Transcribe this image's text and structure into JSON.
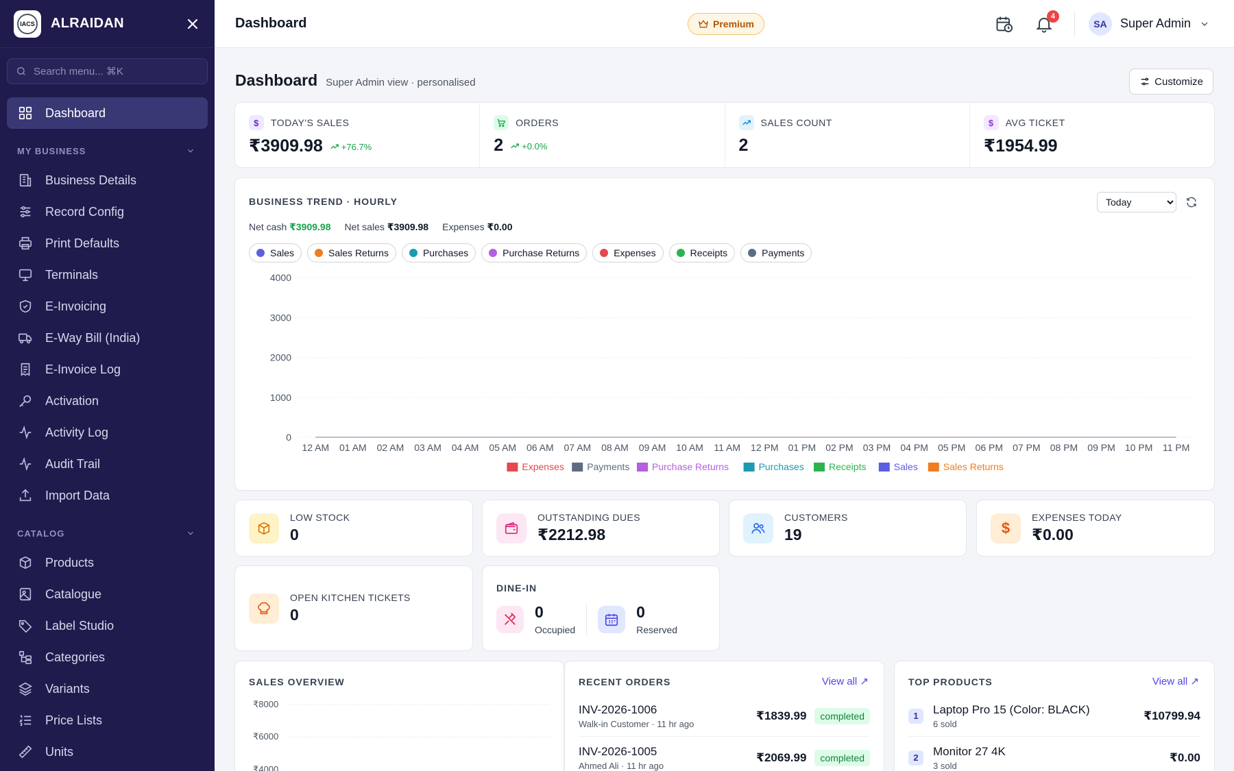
{
  "sidebar": {
    "brand": "ALRAIDAN",
    "logo_text": "IACS",
    "search_placeholder": "Search menu... ⌘K",
    "active_item": "Dashboard",
    "sections": [
      {
        "label": "MY BUSINESS",
        "items": [
          "Business Details",
          "Record Config",
          "Print Defaults",
          "Terminals",
          "E-Invoicing",
          "E-Way Bill (India)",
          "E-Invoice Log",
          "Activation",
          "Activity Log",
          "Audit Trail",
          "Import Data"
        ]
      },
      {
        "label": "CATALOG",
        "items": [
          "Products",
          "Catalogue",
          "Label Studio",
          "Categories",
          "Variants",
          "Price Lists",
          "Units"
        ]
      }
    ]
  },
  "topbar": {
    "title": "Dashboard",
    "premium": "Premium",
    "notifications_count": "4",
    "avatar_initials": "SA",
    "user_name": "Super Admin"
  },
  "page": {
    "title": "Dashboard",
    "subtitle": "Super Admin view · personalised",
    "customize_label": "Customize"
  },
  "kpis": [
    {
      "label": "TODAY'S SALES",
      "value": "₹3909.98",
      "trend": "+76.7%",
      "icon": "dollar-icon"
    },
    {
      "label": "ORDERS",
      "value": "2",
      "trend": "+0.0%",
      "icon": "cart-icon"
    },
    {
      "label": "SALES COUNT",
      "value": "2",
      "trend": "",
      "icon": "trend-up-icon"
    },
    {
      "label": "AVG TICKET",
      "value": "₹1954.99",
      "trend": "",
      "icon": "dollar-icon"
    }
  ],
  "trend": {
    "title": "BUSINESS TREND · HOURLY",
    "range_selected": "Today",
    "stats": [
      {
        "label": "Net cash",
        "value": "₹3909.98"
      },
      {
        "label": "Net sales",
        "value": "₹3909.98"
      },
      {
        "label": "Expenses",
        "value": "₹0.00"
      }
    ],
    "pills": [
      {
        "label": "Sales",
        "color": "#5b5fe0"
      },
      {
        "label": "Sales Returns",
        "color": "#f07c1e"
      },
      {
        "label": "Purchases",
        "color": "#1b9bb0"
      },
      {
        "label": "Purchase Returns",
        "color": "#b45ee0"
      },
      {
        "label": "Expenses",
        "color": "#e5484d"
      },
      {
        "label": "Receipts",
        "color": "#2cb34f"
      },
      {
        "label": "Payments",
        "color": "#5d6b85"
      }
    ]
  },
  "chart_data": {
    "type": "line",
    "x": [
      "12 AM",
      "01 AM",
      "02 AM",
      "03 AM",
      "04 AM",
      "05 AM",
      "06 AM",
      "07 AM",
      "08 AM",
      "09 AM",
      "10 AM",
      "11 AM",
      "12 PM",
      "01 PM",
      "02 PM",
      "03 PM",
      "04 PM",
      "05 PM",
      "06 PM",
      "07 PM",
      "08 PM",
      "09 PM",
      "10 PM",
      "11 PM"
    ],
    "yticks": [
      "0",
      "1000",
      "2000",
      "3000",
      "4000"
    ],
    "ylim": [
      0,
      4000
    ],
    "grid": true,
    "legend_position": "bottom",
    "series": [
      {
        "name": "Expenses",
        "color": "#e5484d",
        "values": [
          0,
          0,
          0,
          0,
          0,
          0,
          0,
          0,
          0,
          0,
          0,
          0,
          0,
          0,
          0,
          0,
          0,
          0,
          0,
          0,
          0,
          0,
          0,
          0
        ]
      },
      {
        "name": "Payments",
        "color": "#5d6b85",
        "values": [
          0,
          0,
          0,
          0,
          0,
          0,
          0,
          0,
          0,
          0,
          0,
          0,
          0,
          0,
          0,
          0,
          0,
          0,
          0,
          0,
          0,
          0,
          0,
          0
        ]
      },
      {
        "name": "Purchase Returns",
        "color": "#b45ee0",
        "values": [
          0,
          0,
          0,
          0,
          0,
          0,
          0,
          0,
          0,
          0,
          0,
          0,
          0,
          0,
          0,
          0,
          0,
          0,
          0,
          0,
          0,
          0,
          0,
          0
        ]
      },
      {
        "name": "Purchases",
        "color": "#1b9bb0",
        "values": [
          0,
          0,
          0,
          0,
          0,
          0,
          0,
          0,
          0,
          0,
          0,
          0,
          0,
          0,
          0,
          0,
          0,
          0,
          0,
          0,
          0,
          0,
          0,
          0
        ]
      },
      {
        "name": "Receipts",
        "color": "#2cb34f",
        "values": [
          0,
          0,
          0,
          0,
          0,
          0,
          0,
          0,
          0,
          0,
          0,
          0,
          0,
          0,
          0,
          0,
          0,
          0,
          0,
          0,
          0,
          0,
          0,
          0
        ]
      },
      {
        "name": "Sales",
        "color": "#5b5fe0",
        "values": [
          0,
          0,
          0,
          0,
          0,
          0,
          0,
          0,
          0,
          0,
          0,
          0,
          0,
          0,
          0,
          0,
          0,
          0,
          0,
          0,
          0,
          0,
          0,
          0
        ]
      },
      {
        "name": "Sales Returns",
        "color": "#f07c1e",
        "values": [
          0,
          0,
          0,
          0,
          0,
          0,
          0,
          0,
          0,
          0,
          0,
          0,
          0,
          0,
          0,
          0,
          0,
          0,
          0,
          0,
          0,
          0,
          0,
          0
        ]
      }
    ]
  },
  "mini_cards": [
    {
      "label": "LOW STOCK",
      "value": "0"
    },
    {
      "label": "OUTSTANDING DUES",
      "value": "₹2212.98"
    },
    {
      "label": "CUSTOMERS",
      "value": "19"
    },
    {
      "label": "EXPENSES TODAY",
      "value": "₹0.00"
    },
    {
      "label": "OPEN KITCHEN TICKETS",
      "value": "0"
    }
  ],
  "dine_in": {
    "title": "DINE-IN",
    "occupied": {
      "value": "0",
      "label": "Occupied"
    },
    "reserved": {
      "value": "0",
      "label": "Reserved"
    }
  },
  "sales_overview": {
    "title": "SALES OVERVIEW",
    "yticks": [
      "₹8000",
      "₹6000",
      "₹4000"
    ]
  },
  "recent_orders": {
    "title": "RECENT ORDERS",
    "view_all": "View all ↗",
    "rows": [
      {
        "id": "INV-2026-1006",
        "meta": "Walk-in Customer · 11 hr ago",
        "amount": "₹1839.99",
        "status": "completed"
      },
      {
        "id": "INV-2026-1005",
        "meta": "Ahmed Ali · 11 hr ago",
        "amount": "₹2069.99",
        "status": "completed"
      }
    ]
  },
  "top_products": {
    "title": "TOP PRODUCTS",
    "view_all": "View all ↗",
    "rows": [
      {
        "rank": "1",
        "name": "Laptop Pro 15 (Color: BLACK)",
        "sold": "6 sold",
        "amount": "₹10799.94"
      },
      {
        "rank": "2",
        "name": "Monitor 27 4K",
        "sold": "3 sold",
        "amount": "₹0.00"
      }
    ]
  }
}
